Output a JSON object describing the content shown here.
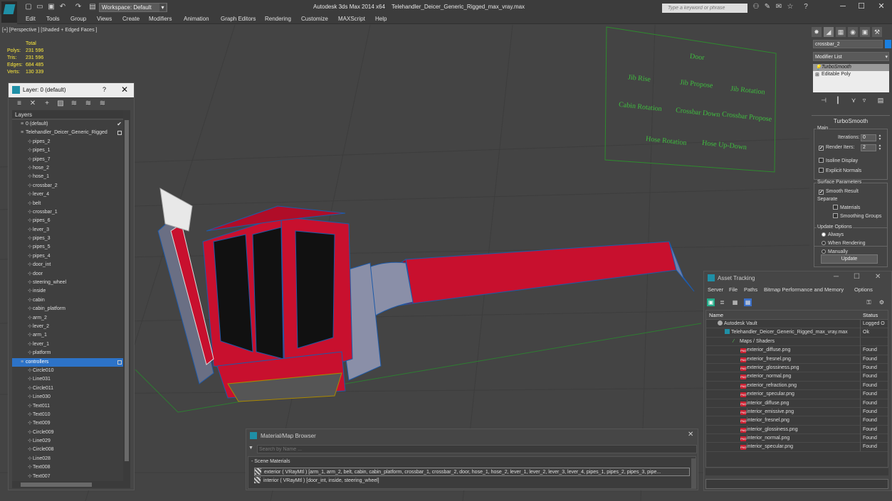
{
  "titlebar": {
    "workspace": "Workspace: Default",
    "app_title": "Autodesk 3ds Max  2014 x64",
    "file_title": "Telehandler_Deicer_Generic_Rigged_max_vray.max",
    "search_placeholder": "Type a keyword or phrase"
  },
  "menu": [
    "Edit",
    "Tools",
    "Group",
    "Views",
    "Create",
    "Modifiers",
    "Animation",
    "Graph Editors",
    "Rendering",
    "Customize",
    "MAXScript",
    "Help"
  ],
  "viewport": {
    "label": "[+] [Perspective ] [Shaded + Edged Faces ]",
    "stats_header": "Total",
    "stats": [
      {
        "label": "Polys:",
        "value": "231 596"
      },
      {
        "label": "Tris:",
        "value": "231 596"
      },
      {
        "label": "Edges:",
        "value": "684 485"
      },
      {
        "label": "Verts:",
        "value": "130 339"
      }
    ],
    "controls": [
      "Door",
      "Jib Rise",
      "Jib Propose",
      "Jib Rotation",
      "Cabin Rotation",
      "Crossbar Down",
      "Crossbar Propose",
      "Hose Rotation",
      "Hose Up-Down"
    ]
  },
  "layer_dialog": {
    "title": "Layer: 0 (default)",
    "help": "?",
    "header": "Layers",
    "rows": [
      {
        "label": "0 (default)",
        "level": 1,
        "type": "layer",
        "check": true
      },
      {
        "label": "Telehandler_Deicer_Generic_Rigged",
        "level": 1,
        "type": "layer",
        "box": true
      },
      {
        "label": "pipes_2",
        "level": 2
      },
      {
        "label": "pipes_1",
        "level": 2
      },
      {
        "label": "pipes_7",
        "level": 2
      },
      {
        "label": "hose_2",
        "level": 2
      },
      {
        "label": "hose_1",
        "level": 2
      },
      {
        "label": "crossbar_2",
        "level": 2
      },
      {
        "label": "lever_4",
        "level": 2
      },
      {
        "label": "belt",
        "level": 2
      },
      {
        "label": "crossbar_1",
        "level": 2
      },
      {
        "label": "pipes_6",
        "level": 2
      },
      {
        "label": "lever_3",
        "level": 2
      },
      {
        "label": "pipes_3",
        "level": 2
      },
      {
        "label": "pipes_5",
        "level": 2
      },
      {
        "label": "pipes_4",
        "level": 2
      },
      {
        "label": "door_int",
        "level": 2
      },
      {
        "label": "door",
        "level": 2
      },
      {
        "label": "steering_wheel",
        "level": 2
      },
      {
        "label": "inside",
        "level": 2
      },
      {
        "label": "cabin",
        "level": 2
      },
      {
        "label": "cabin_platform",
        "level": 2
      },
      {
        "label": "arm_2",
        "level": 2
      },
      {
        "label": "lever_2",
        "level": 2
      },
      {
        "label": "arm_1",
        "level": 2
      },
      {
        "label": "lever_1",
        "level": 2
      },
      {
        "label": "platform",
        "level": 2
      },
      {
        "label": "controllers",
        "level": 1,
        "type": "layer",
        "box": true,
        "selected": true
      },
      {
        "label": "Circle010",
        "level": 2
      },
      {
        "label": "Line031",
        "level": 2
      },
      {
        "label": "Circle011",
        "level": 2
      },
      {
        "label": "Line030",
        "level": 2
      },
      {
        "label": "Text011",
        "level": 2
      },
      {
        "label": "Text010",
        "level": 2
      },
      {
        "label": "Text009",
        "level": 2
      },
      {
        "label": "Circle009",
        "level": 2
      },
      {
        "label": "Line029",
        "level": 2
      },
      {
        "label": "Circle008",
        "level": 2
      },
      {
        "label": "Line028",
        "level": 2
      },
      {
        "label": "Text008",
        "level": 2
      },
      {
        "label": "Text007",
        "level": 2
      }
    ]
  },
  "command_panel": {
    "object_name": "crossbar_2",
    "modifier_list": "Modifier List",
    "stack": [
      "TurboSmooth",
      "Editable Poly"
    ],
    "rollout_title": "TurboSmooth",
    "main_label": "Main",
    "iterations_label": "Iterations:",
    "iterations_value": "0",
    "render_iters_label": "Render Iters:",
    "render_iters_value": "2",
    "isoline": "Isoline Display",
    "explicit": "Explicit Normals",
    "surface_label": "Surface Parameters",
    "smooth_result": "Smooth Result",
    "separate_label": "Separate",
    "materials": "Materials",
    "smoothing_groups": "Smoothing Groups",
    "update_label": "Update Options",
    "always": "Always",
    "when_rendering": "When Rendering",
    "manually": "Manually",
    "update_button": "Update",
    "color": "#1a7fe0"
  },
  "asset_tracking": {
    "title": "Asset Tracking",
    "menu": [
      "Server",
      "File",
      "Paths",
      "Bitmap Performance and Memory",
      "Options"
    ],
    "col_name": "Name",
    "col_status": "Status",
    "rows": [
      {
        "name": "Autodesk Vault",
        "status": "Logged O",
        "icon": "vault",
        "indent": 16
      },
      {
        "name": "Telehandler_Deicer_Generic_Rigged_max_vray.max",
        "status": "Ok",
        "icon": "max",
        "indent": 26
      },
      {
        "name": "Maps / Shaders",
        "status": "",
        "icon": "maps",
        "indent": 38
      },
      {
        "name": "exterior_diffuse.png",
        "status": "Found",
        "icon": "png",
        "indent": 48
      },
      {
        "name": "exterior_fresnel.png",
        "status": "Found",
        "icon": "png",
        "indent": 48
      },
      {
        "name": "exterior_glossiness.png",
        "status": "Found",
        "icon": "png",
        "indent": 48
      },
      {
        "name": "exterior_normal.png",
        "status": "Found",
        "icon": "png",
        "indent": 48
      },
      {
        "name": "exterior_refraction.png",
        "status": "Found",
        "icon": "png",
        "indent": 48
      },
      {
        "name": "exterior_specular.png",
        "status": "Found",
        "icon": "png",
        "indent": 48
      },
      {
        "name": "interior_diffuse.png",
        "status": "Found",
        "icon": "png",
        "indent": 48
      },
      {
        "name": "interior_emissive.png",
        "status": "Found",
        "icon": "png",
        "indent": 48
      },
      {
        "name": "interior_fresnel.png",
        "status": "Found",
        "icon": "png",
        "indent": 48
      },
      {
        "name": "interior_glossiness.png",
        "status": "Found",
        "icon": "png",
        "indent": 48
      },
      {
        "name": "interior_normal.png",
        "status": "Found",
        "icon": "png",
        "indent": 48
      },
      {
        "name": "interior_specular.png",
        "status": "Found",
        "icon": "png",
        "indent": 48
      }
    ]
  },
  "material_browser": {
    "title": "Material/Map Browser",
    "search_placeholder": "Search by Name ...",
    "section": "- Scene Materials",
    "rows": [
      "exterior  ( VRayMtl ) [arm_1, arm_2, belt, cabin, cabin_platform, crossbar_1, crossbar_2, door, hose_1, hose_2, lever_1, lever_2, lever_3, lever_4, pipes_1, pipes_2, pipes_3, pipe...",
      "interior  ( VRayMtl ) [door_int, inside, steering_wheel]"
    ]
  },
  "colors": {
    "model_red": "#c8102e",
    "wire_blue": "#1e5aa8",
    "control_green": "#3fbf3f",
    "stats_yellow": "#ffeb3b",
    "selection_blue": "#2d73c8"
  }
}
